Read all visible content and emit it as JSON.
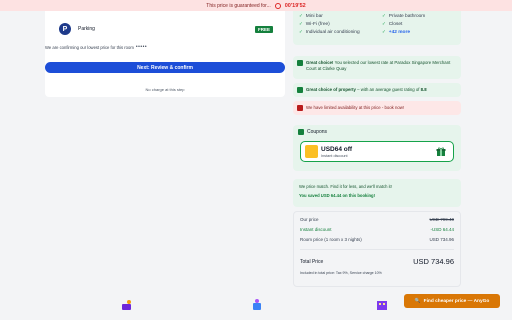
{
  "banner": {
    "text": "This price is guaranteed for...",
    "timer": "00'19'52"
  },
  "left": {
    "parking_label": "Parking",
    "parking_badge": "FREE",
    "confirming_text": "We are confirming our lowest price for this room",
    "next_button": "Next: Review & confirm",
    "no_charge": "No charge at this step"
  },
  "amenities": {
    "col1": [
      "Mini bar",
      "Wi-Fi (free)",
      "Individual air conditioning"
    ],
    "col2": [
      "Private bathroom",
      "Closet"
    ],
    "more": "+42 more"
  },
  "messages": {
    "great_choice_bold": "Great choice!",
    "great_choice_text": "You selected our lowest rate at Paradox Singapore Merchant Court at Clarke Quay",
    "great_property_bold": "Great choice of property",
    "great_property_text": "– with an average guest rating of",
    "rating": "8.8",
    "limited_text": "We have limited availability at this price - book now!"
  },
  "coupons": {
    "title": "Coupons",
    "amount": "USD64 off",
    "subtitle": "Instant discount"
  },
  "price_match": {
    "line1": "We price match. Find it for less, and we'll match it!",
    "line2": "You saved USD 64.44 on this booking!"
  },
  "price": {
    "our_price_label": "Our price",
    "our_price_value": "USD 799.40",
    "instant_label": "Instant discount",
    "instant_value": "-USD 64.44",
    "room_label": "Room price (1 room x 3 nights)",
    "room_value": "USD 734.96",
    "total_label": "Total Price",
    "total_value": "USD 734.96",
    "included": "Included in total price: Tax 9%, Service charge 10%"
  },
  "find_button": "Find cheaper price — AnyGo",
  "colors": {
    "primary": "#1d4ed8",
    "green": "#15803d",
    "alert": "#dc2626",
    "orange": "#d97706"
  }
}
